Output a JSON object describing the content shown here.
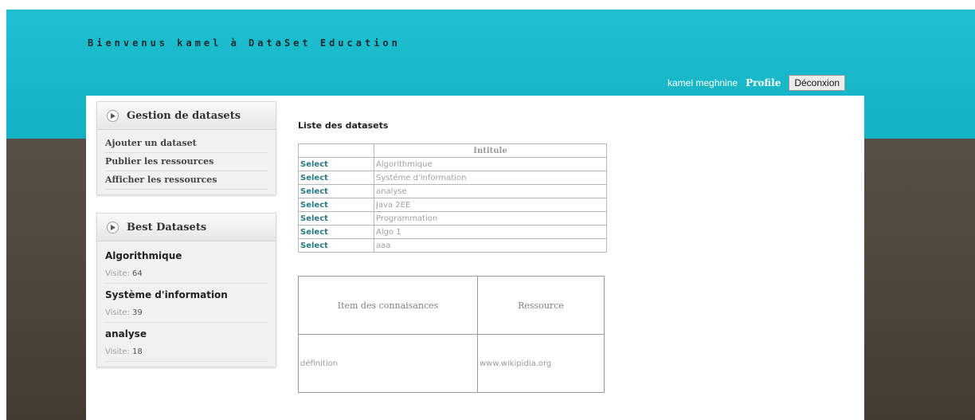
{
  "header": {
    "title": "Bienvenus kamel à DataSet Education",
    "user_name": "kamel meghnine",
    "profile_label": "Profile",
    "logout_label": "Déconxion"
  },
  "sidebar": {
    "gestion": {
      "title": "Gestion de datasets",
      "items": [
        {
          "label": "Ajouter un dataset"
        },
        {
          "label": "Publier les ressources"
        },
        {
          "label": "Afficher les ressources"
        }
      ]
    },
    "best": {
      "title": "Best Datasets",
      "visit_label": "Visite:",
      "items": [
        {
          "title": "Algorithmique",
          "visits": "64"
        },
        {
          "title": "Système d'information",
          "visits": "39"
        },
        {
          "title": "analyse",
          "visits": "18"
        }
      ]
    }
  },
  "main": {
    "list_heading": "Liste des datasets",
    "datasets_table": {
      "header": "Intitule",
      "select_label": "Select",
      "rows": [
        {
          "name": "Algorithmique"
        },
        {
          "name": "Systéme d'information"
        },
        {
          "name": "analyse"
        },
        {
          "name": "Java 2EE"
        },
        {
          "name": "Programmation"
        },
        {
          "name": "Algo 1"
        },
        {
          "name": "aaa"
        }
      ]
    },
    "items_table": {
      "col1": "Item des connaisances",
      "col2": "Ressource",
      "rows": [
        {
          "item": "définition",
          "resource": "www.wikipidia.org"
        }
      ]
    }
  },
  "icons": {
    "panel_icon": "play-circle-icon"
  }
}
